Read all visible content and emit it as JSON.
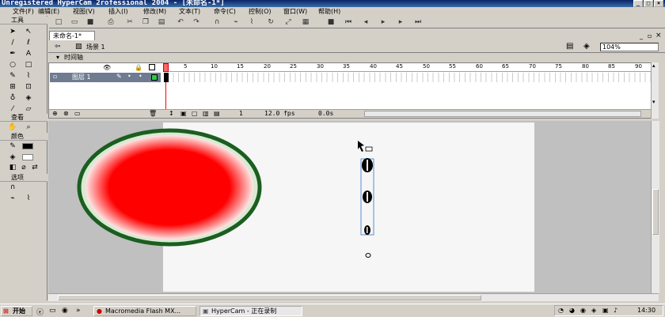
{
  "titlebar": {
    "title": "Unregistered HyperCam 2rofessional 2004 - [未命名-1*]"
  },
  "menu": [
    "文件(F)",
    "编辑(E)",
    "视图(V)",
    "插入(I)",
    "修改(M)",
    "文本(T)",
    "命令(C)",
    "控制(O)",
    "窗口(W)",
    "帮助(H)"
  ],
  "tools": {
    "header": "工具",
    "view_header": "查看",
    "colors_header": "颜色",
    "options_header": "选项"
  },
  "document": {
    "tab": "未命名-1*",
    "scene": "场景 1",
    "zoom": "104%"
  },
  "timeline": {
    "header": "时间轴",
    "layer": "图层 1",
    "frame_numbers": [
      "5",
      "10",
      "15",
      "20",
      "25",
      "30",
      "35",
      "40",
      "45",
      "50",
      "55",
      "60",
      "65",
      "70",
      "75",
      "80",
      "85",
      "90"
    ],
    "current_frame": "1",
    "fps": "12.0 fps",
    "time": "0.0s"
  },
  "taskbar": {
    "start": "开始",
    "tasks": [
      "Macromedia Flash MX...",
      "HyperCam - 正在录制"
    ],
    "clock": "14:30"
  },
  "colors": {
    "title_start": "#0a246a",
    "circle_fill": "#ff0000",
    "circle_stroke": "#2e7d32"
  }
}
